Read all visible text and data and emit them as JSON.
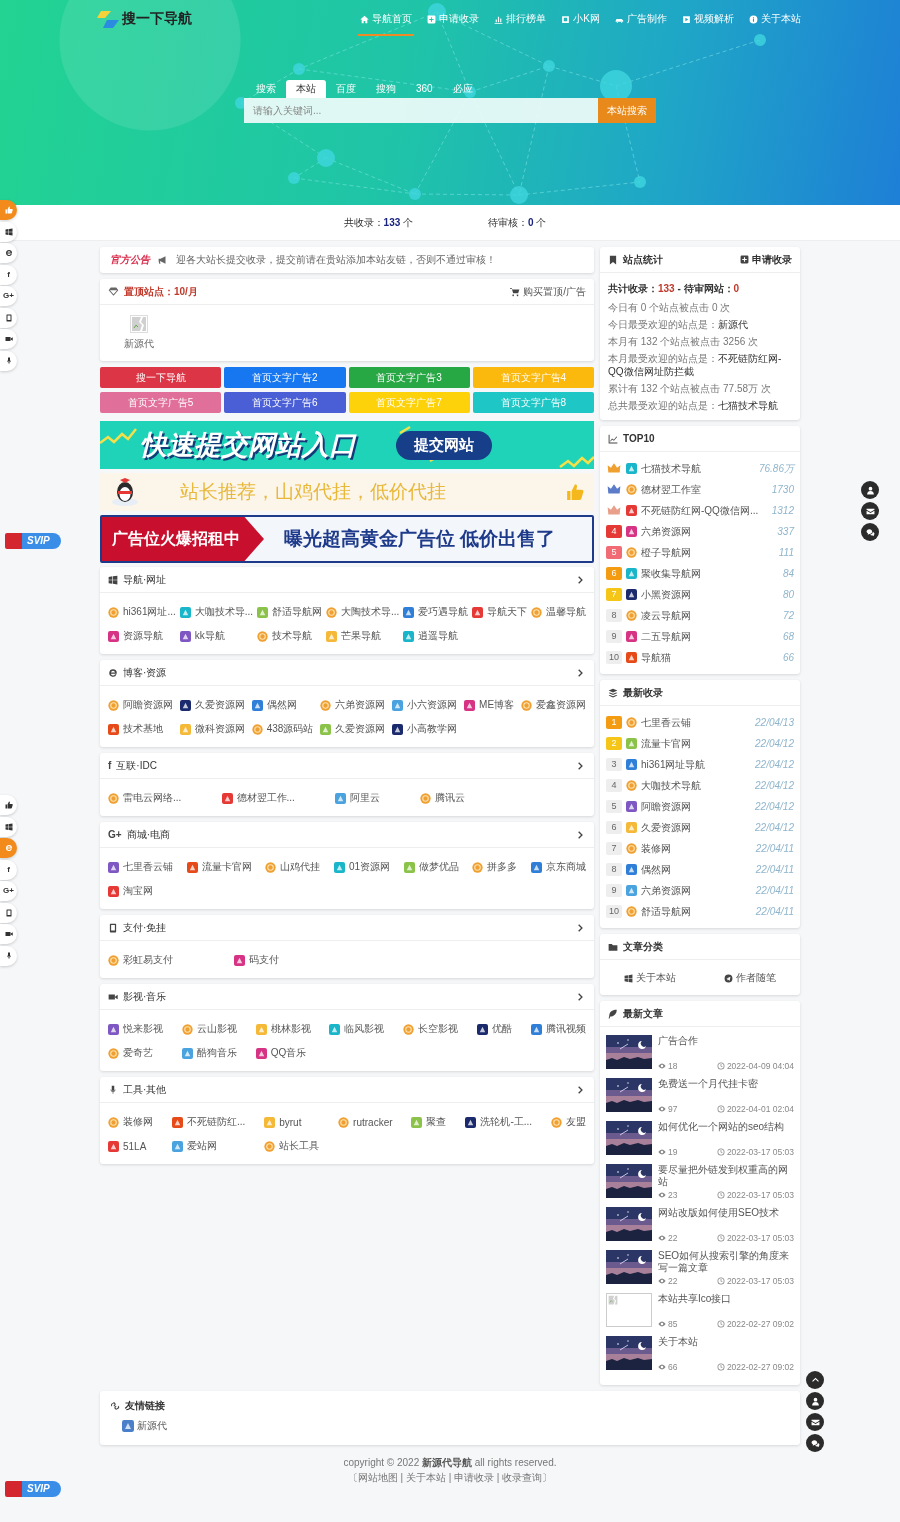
{
  "header": {
    "logo": "搜一下导航",
    "nav": [
      {
        "label": "导航首页",
        "selected": true
      },
      {
        "label": "申请收录",
        "selected": false
      },
      {
        "label": "排行榜单",
        "selected": false
      },
      {
        "label": "小K网",
        "selected": false
      },
      {
        "label": "广告制作",
        "selected": false
      },
      {
        "label": "视频解析",
        "selected": false
      },
      {
        "label": "关于本站",
        "selected": false
      }
    ]
  },
  "search": {
    "tabs": [
      {
        "label": "搜索",
        "selected": false
      },
      {
        "label": "本站",
        "selected": true
      },
      {
        "label": "百度",
        "selected": false
      },
      {
        "label": "搜狗",
        "selected": false
      },
      {
        "label": "360",
        "selected": false
      },
      {
        "label": "必应",
        "selected": false
      }
    ],
    "placeholder": "请输入关键词...",
    "button": "本站搜索"
  },
  "summary": [
    "共收录：**133** 个",
    "待审核：**0** 个"
  ],
  "notice": {
    "title": "官方公告",
    "text": "迎各大站长提交收录，提交前请在贵站添加本站友链，否则不通过审核！"
  },
  "sticky": {
    "title": "置顶站点：10/月",
    "action": "购买置顶/广告",
    "items": [
      "新源代"
    ]
  },
  "text_ads": [
    {
      "label": "搜一下导航",
      "color": "#dc3545"
    },
    {
      "label": "首页文字广告2",
      "color": "#1677f0"
    },
    {
      "label": "首页文字广告3",
      "color": "#28a745"
    },
    {
      "label": "首页文字广告4",
      "color": "#fbb80d"
    },
    {
      "label": "首页文字广告5",
      "color": "#e0709a"
    },
    {
      "label": "首页文字广告6",
      "color": "#4a5ed6"
    },
    {
      "label": "首页文字广告7",
      "color": "#fdd20a"
    },
    {
      "label": "首页文字广告8",
      "color": "#1ec6c6"
    }
  ],
  "banners": [
    {
      "kind": "submit",
      "text": "快速提交网站入口",
      "button": "提交网站"
    },
    {
      "kind": "promo",
      "text": "站长推荐，山鸡代挂，低价代挂"
    },
    {
      "kind": "rent",
      "tag": "广告位火爆招租中",
      "text": "曝光超高黄金广告位 低价出售了"
    }
  ],
  "categories": [
    {
      "title": "导航·网址",
      "sites": [
        "hi361网址...",
        "大咖技术导...",
        "舒适导航网",
        "大陶技术导...",
        "爱巧遇导航",
        "导航天下",
        "温馨导航",
        "资源导航",
        "kk导航",
        "技术导航",
        "芒果导航",
        "逍遥导航"
      ]
    },
    {
      "title": "博客·资源",
      "sites": [
        "阿瞻资源网",
        "久爱资源网",
        "偶然网",
        "六弟资源网",
        "小六资源网",
        "ME博客",
        "爱鑫资源网",
        "技术基地",
        "微科资源网",
        "438源码站",
        "久爱资源网",
        "小高教学网"
      ]
    },
    {
      "title": "互联·IDC",
      "glyph": "f",
      "sites": [
        "雷电云网络...",
        "德材翌工作...",
        "阿里云",
        "腾讯云"
      ]
    },
    {
      "title": "商城·电商",
      "glyph": "G+",
      "sites": [
        "七里香云铺",
        "流量卡官网",
        "山鸡代挂",
        "01资源网",
        "做梦优品",
        "拼多多",
        "京东商城",
        "淘宝网"
      ]
    },
    {
      "title": "支付·免挂",
      "sites": [
        "彩虹易支付",
        "码支付"
      ]
    },
    {
      "title": "影视·音乐",
      "sites": [
        "悦来影视",
        "云山影视",
        "桃林影视",
        "临风影视",
        "长空影视",
        "优酷",
        "腾讯视频",
        "爱奇艺",
        "酷狗音乐",
        "QQ音乐"
      ]
    },
    {
      "title": "工具·其他",
      "sites": [
        "装修网",
        "不死链防红...",
        "byrut",
        "rutracker",
        "聚查",
        "洗轮机-工...",
        "友盟",
        "51LA",
        "爱站网",
        "站长工具"
      ]
    }
  ],
  "stats": {
    "title": "站点统计",
    "action": "申请收录",
    "total": "共计收录：**133** - 待审网站：**0**",
    "lines": [
      "今日有 0 个站点被点击 0 次",
      "今日最受欢迎的站点是：**新源代**",
      "本月有 132 个站点被点击 3256 次",
      "本月最受欢迎的站点是：**不死链防红网-QQ微信网址防拦截**",
      "累计有 132 个站点被点击 77.58万 次",
      "总共最受欢迎的站点是：**七猫技术导航**"
    ]
  },
  "top10": {
    "title": "TOP10",
    "rows": [
      {
        "kind": "crown",
        "color": "#f0a030",
        "name": "七猫技术导航",
        "count": "76.86万"
      },
      {
        "kind": "crown",
        "color": "#5c7cc9",
        "name": "德材翌工作室",
        "count": "1730"
      },
      {
        "kind": "crown",
        "color": "#e8a08a",
        "name": "不死链防红网-QQ微信网...",
        "count": "1312"
      },
      {
        "kind": "badge",
        "rank": "4",
        "color": "#e53935",
        "name": "六弟资源网",
        "count": "337"
      },
      {
        "kind": "badge",
        "rank": "5",
        "color": "#f06b73",
        "name": "橙子导航网",
        "count": "111"
      },
      {
        "kind": "badge",
        "rank": "6",
        "color": "#f39c12",
        "name": "聚收集导航网",
        "count": "84"
      },
      {
        "kind": "badge",
        "rank": "7",
        "color": "#f5c518",
        "name": "小黑资源网",
        "count": "80"
      },
      {
        "kind": "badge",
        "rank": "8",
        "color": "#eeeeee",
        "name": "凌云导航网",
        "count": "72"
      },
      {
        "kind": "badge",
        "rank": "9",
        "color": "#eeeeee",
        "name": "二五导航网",
        "count": "68"
      },
      {
        "kind": "badge",
        "rank": "10",
        "color": "#eeeeee",
        "name": "导航猫",
        "count": "66"
      }
    ]
  },
  "latest": {
    "title": "最新收录",
    "rows": [
      {
        "kind": "badge",
        "rank": "1",
        "color": "#f39c12",
        "name": "七里香云铺",
        "count": "22/04/13"
      },
      {
        "kind": "badge",
        "rank": "2",
        "color": "#f5c518",
        "name": "流量卡官网",
        "count": "22/04/12"
      },
      {
        "kind": "badge",
        "rank": "3",
        "color": "#eeeeee",
        "name": "hi361网址导航",
        "count": "22/04/12"
      },
      {
        "kind": "badge",
        "rank": "4",
        "color": "#eeeeee",
        "name": "大咖技术导航",
        "count": "22/04/12"
      },
      {
        "kind": "badge",
        "rank": "5",
        "color": "#eeeeee",
        "name": "阿瞻资源网",
        "count": "22/04/12"
      },
      {
        "kind": "badge",
        "rank": "6",
        "color": "#eeeeee",
        "name": "久爱资源网",
        "count": "22/04/12"
      },
      {
        "kind": "badge",
        "rank": "7",
        "color": "#eeeeee",
        "name": "装修网",
        "count": "22/04/11"
      },
      {
        "kind": "badge",
        "rank": "8",
        "color": "#eeeeee",
        "name": "偶然网",
        "count": "22/04/11"
      },
      {
        "kind": "badge",
        "rank": "9",
        "color": "#eeeeee",
        "name": "六弟资源网",
        "count": "22/04/11"
      },
      {
        "kind": "badge",
        "rank": "10",
        "color": "#eeeeee",
        "name": "舒适导航网",
        "count": "22/04/11"
      }
    ]
  },
  "article_categories": {
    "title": "文章分类",
    "items": [
      "关于本站",
      "作者随笔"
    ]
  },
  "articles": {
    "title": "最新文章",
    "items": [
      {
        "title": "广告合作",
        "kind": "picture",
        "views": "18",
        "date": "2022-04-09 04:04"
      },
      {
        "title": "免费送一个月代挂卡密",
        "kind": "picture",
        "views": "97",
        "date": "2022-04-01 02:04"
      },
      {
        "title": "如何优化一个网站的seo结构",
        "kind": "picture",
        "views": "19",
        "date": "2022-03-17 05:03"
      },
      {
        "title": "要尽量把外链发到权重高的网站",
        "kind": "picture",
        "views": "23",
        "date": "2022-03-17 05:03"
      },
      {
        "title": "网站改版如何使用SEO技术",
        "kind": "picture",
        "views": "22",
        "date": "2022-03-17 05:03"
      },
      {
        "title": "SEO如何从搜索引擎的角度来写一篇文章",
        "kind": "picture",
        "views": "22",
        "date": "2022-03-17 05:03"
      },
      {
        "title": "本站共享Ico接口",
        "kind": "missing",
        "views": "85",
        "date": "2022-02-27 09:02"
      },
      {
        "title": "关于本站",
        "kind": "picture",
        "views": "66",
        "date": "2022-02-27 09:02"
      }
    ]
  },
  "friend_links": {
    "title": "友情链接",
    "links": [
      "新源代"
    ]
  },
  "footer": {
    "copyright": "copyright © 2022 **新源代导航** all rights reserved.",
    "links": "〔网站地图 | 关于本站 | 申请收录 | 收录查询〕"
  },
  "side_toolbars": [
    {
      "items": [
        {
          "selected": true
        },
        {
          "selected": false
        },
        {
          "selected": false
        },
        {
          "glyph": "f",
          "selected": false
        },
        {
          "glyph": "G+",
          "selected": false
        },
        {
          "selected": false
        },
        {
          "selected": false
        },
        {
          "selected": false
        }
      ]
    },
    {
      "items": [
        {
          "selected": false
        },
        {
          "selected": false
        },
        {
          "selected": true
        },
        {
          "glyph": "f",
          "selected": false
        },
        {
          "glyph": "G+",
          "selected": false
        },
        {
          "selected": false
        },
        {
          "selected": false
        },
        {
          "selected": false
        }
      ]
    }
  ],
  "vip_badges": [
    "SVIP",
    "SVIP"
  ]
}
